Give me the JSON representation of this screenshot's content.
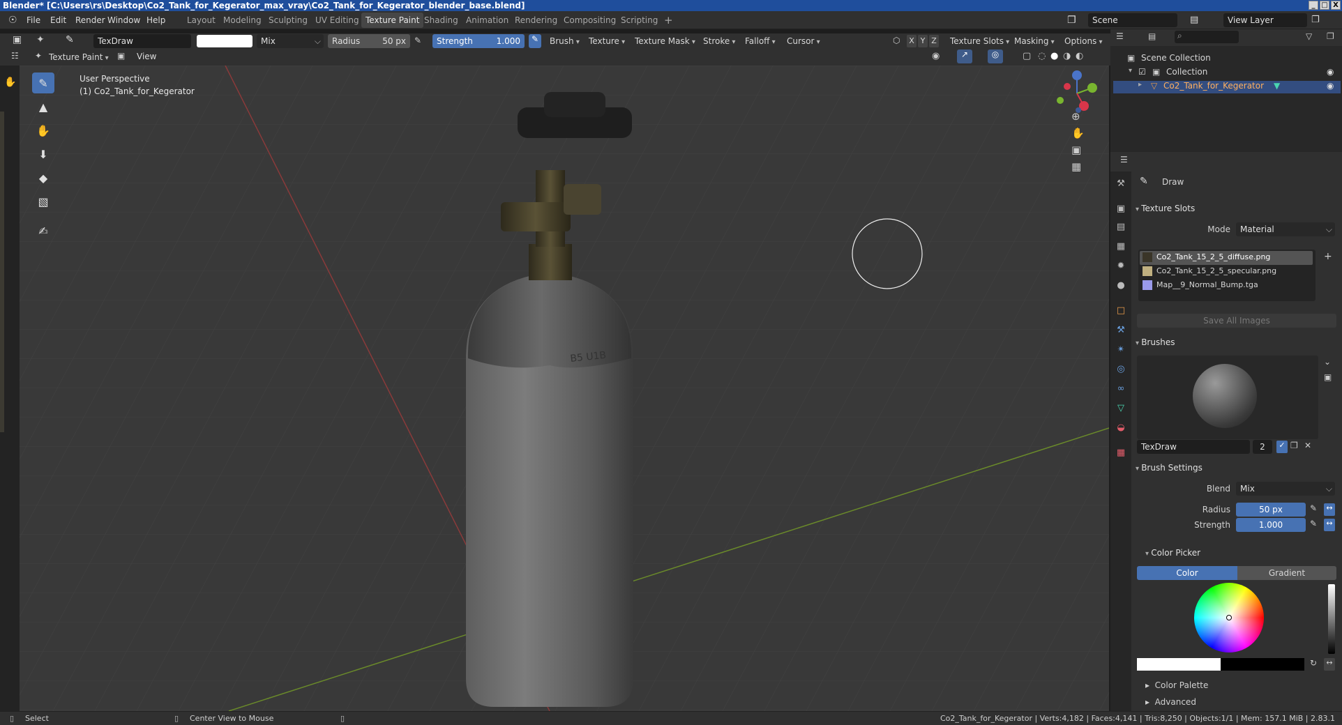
{
  "window": {
    "title": "Blender* [C:\\Users\\rs\\Desktop\\Co2_Tank_for_Kegerator_max_vray\\Co2_Tank_for_Kegerator_blender_base.blend]",
    "controls": [
      "_",
      "□",
      "X"
    ]
  },
  "menu": {
    "items": [
      "File",
      "Edit",
      "Render",
      "Window",
      "Help"
    ]
  },
  "workspaces": [
    "Layout",
    "Modeling",
    "Sculpting",
    "UV Editing",
    "Texture Paint",
    "Shading",
    "Animation",
    "Rendering",
    "Compositing",
    "Scripting"
  ],
  "active_workspace": "Texture Paint",
  "scene": {
    "name": "Scene",
    "view_layer": "View Layer"
  },
  "tool_header": {
    "brush_name": "TexDraw",
    "color": "#ffffff",
    "blend": "Mix",
    "radius_label": "Radius",
    "radius_value": "50 px",
    "strength_label": "Strength",
    "strength_value": "1.000",
    "menus": [
      "Brush",
      "Texture",
      "Texture Mask",
      "Stroke",
      "Falloff",
      "Cursor"
    ],
    "axes": [
      "X",
      "Y",
      "Z"
    ],
    "right_menus": [
      "Texture Slots",
      "Masking",
      "Options"
    ]
  },
  "viewport_header": {
    "mode": "Texture Paint",
    "view": "View"
  },
  "viewport": {
    "perspective": "User Perspective",
    "object": "(1) Co2_Tank_for_Kegerator",
    "tank_markings": "B5 U1B"
  },
  "outliner": {
    "root": "Scene Collection",
    "collection": "Collection",
    "object": "Co2_Tank_for_Kegerator"
  },
  "properties": {
    "tool_name": "Draw",
    "texture_slots": {
      "title": "Texture Slots",
      "mode_label": "Mode",
      "mode_value": "Material",
      "slots": [
        "Co2_Tank_15_2_5_diffuse.png",
        "Co2_Tank_15_2_5_specular.png",
        "Map__9_Normal_Bump.tga"
      ],
      "save_all": "Save All Images"
    },
    "brushes": {
      "title": "Brushes",
      "brush_name": "TexDraw",
      "users": "2"
    },
    "brush_settings": {
      "title": "Brush Settings",
      "blend_label": "Blend",
      "blend_value": "Mix",
      "radius_label": "Radius",
      "radius_value": "50 px",
      "strength_label": "Strength",
      "strength_value": "1.000"
    },
    "color_picker": {
      "title": "Color Picker",
      "tab_color": "Color",
      "tab_gradient": "Gradient"
    },
    "color_palette": "Color Palette",
    "advanced": "Advanced"
  },
  "statusbar": {
    "select": "Select",
    "center": "Center View to Mouse",
    "stats": "Co2_Tank_for_Kegerator | Verts:4,182 | Faces:4,141 | Tris:8,250 | Objects:1/1 | Mem: 157.1 MiB | 2.83.1"
  }
}
